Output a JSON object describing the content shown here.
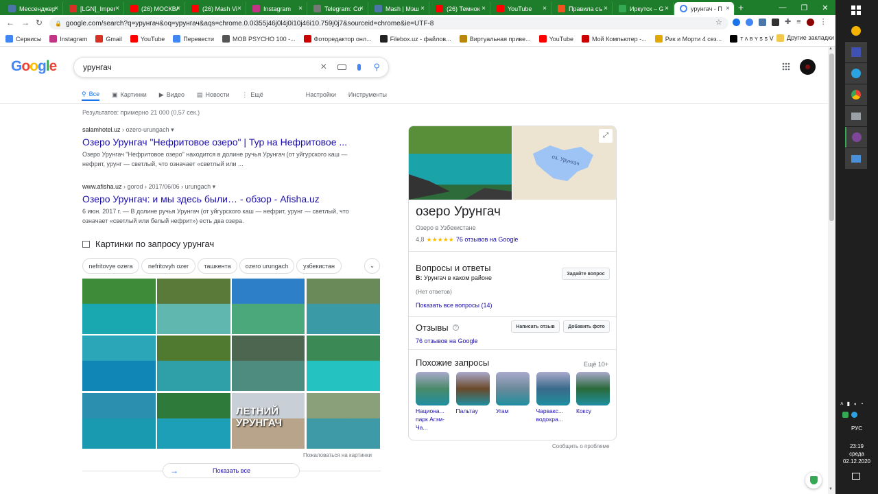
{
  "browser": {
    "tabs": [
      {
        "title": "Мессенджер",
        "color": "#4a76a8"
      },
      {
        "title": "[LGN]_Imper",
        "color": "#d93025"
      },
      {
        "title": "(26) МОСКВА",
        "color": "#ff0000"
      },
      {
        "title": "(26) Mash Vi",
        "color": "#ff0000"
      },
      {
        "title": "Instagram",
        "color": "#c13584"
      },
      {
        "title": "Telegram: Co",
        "color": "#777777"
      },
      {
        "title": "Mash | Мэш",
        "color": "#4a76a8"
      },
      {
        "title": "(26) Темнок",
        "color": "#ff0000"
      },
      {
        "title": "YouTube",
        "color": "#ff0000"
      },
      {
        "title": "Правила съ",
        "color": "#f4511e"
      },
      {
        "title": "Иркутск – G",
        "color": "#34a853"
      },
      {
        "title": "урунгач - П",
        "color": "#ffffff"
      }
    ],
    "url": "google.com/search?q=урунгач&oq=урунгач&aqs=chrome.0.0i355j46j0l4j0i10j46i10.759j0j7&sourceid=chrome&ie=UTF-8",
    "bookmarks": [
      {
        "label": "Сервисы",
        "color": "#4285f4"
      },
      {
        "label": "Instagram",
        "color": "#c13584"
      },
      {
        "label": "Gmail",
        "color": "#d93025"
      },
      {
        "label": "YouTube",
        "color": "#ff0000"
      },
      {
        "label": "Перевести",
        "color": "#4285f4"
      },
      {
        "label": "MOB PSYCHO 100 -...",
        "color": "#555555"
      },
      {
        "label": "Фоторедактор онл...",
        "color": "#cc0000"
      },
      {
        "label": "Filebox.uz - файлов...",
        "color": "#222222"
      },
      {
        "label": "Виртуальная приве...",
        "color": "#b8860b"
      },
      {
        "label": "YouTube",
        "color": "#ff0000"
      },
      {
        "label": "Мой Компьютер -...",
        "color": "#cc0000"
      },
      {
        "label": "Рик и Морти 4 сез...",
        "color": "#e0a800"
      },
      {
        "label": "ᴛ ʌ ʙ ʏ ꜱ ꜱ ⴸ",
        "color": "#000000"
      }
    ],
    "other_bookmarks": "Другие закладки"
  },
  "search": {
    "query": "урунгач",
    "tabs": [
      "Все",
      "Картинки",
      "Видео",
      "Новости",
      "Ещё"
    ],
    "settings": "Настройки",
    "tools": "Инструменты",
    "stats": "Результатов: примерно 21 000 (0,57 сек.)"
  },
  "results": [
    {
      "site": "salamhotel.uz",
      "path": " › ozero-urungach ▾",
      "title": "Озеро Урунгач \"Нефритовое озеро\" | Тур на Нефритовое ...",
      "snippet": "Озеро Урунгач \"Нефритовое озеро\" находится в долине ручья Урунгач (от уйгурского каш — нефрит, урунг — светлый, что означает «светлый или ..."
    },
    {
      "site": "www.afisha.uz",
      "path": " › gorod › 2017/06/06 › urungach ▾",
      "title": "Озеро Урунгач: и мы здесь были… - обзор - Afisha.uz",
      "snippet": "6 июн. 2017 г. — В долине ручья Урунгач (от уйгурского каш — нефрит, урунг — светлый, что означает «светлый или белый нефрит») есть два озера."
    }
  ],
  "images": {
    "heading": "Картинки по запросу урунгач",
    "chips": [
      "nefritovye ozera",
      "nefritovyh ozer",
      "ташкента",
      "ozero urungach",
      "узбекистан"
    ],
    "overlay": "ЛЕТНИЙ УРУНГАЧ",
    "report": "Пожаловаться на картинки",
    "show_all": "Показать все"
  },
  "panel": {
    "map_label": "оз. Урунгач",
    "title": "озеро Урунгач",
    "subtitle": "Озеро в Узбекистане",
    "rating": "4,8",
    "stars": "★★★★★",
    "reviews_link": "76 отзывов на Google",
    "qa_title": "Вопросы и ответы",
    "qa_question_prefix": "В:",
    "qa_question": " Урунгач в каком районе",
    "ask_button": "Задайте вопрос",
    "no_answers": "(Нет ответов)",
    "show_questions": "Показать все вопросы (14)",
    "reviews_title": "Отзывы",
    "write_review": "Написать отзыв",
    "add_photo": "Добавить фото",
    "reviews_count": "76 отзывов на Google",
    "similar_title": "Похожие запросы",
    "more": "Ещё 10+",
    "similar": [
      "Национа... парк Агэм-Ча...",
      "Пальтау",
      "Угам",
      "Чарвакс... водохра...",
      "Коксу"
    ],
    "report_problem": "Сообщить о проблеме"
  },
  "taskbar": {
    "lang": "РУС",
    "time": "23:19",
    "day": "среда",
    "date": "02.12.2020"
  },
  "colors": {
    "link": "#1a0dab",
    "accent": "#1a73e8",
    "chrome_green": "#1e7d2a",
    "star": "#fbbc04"
  }
}
